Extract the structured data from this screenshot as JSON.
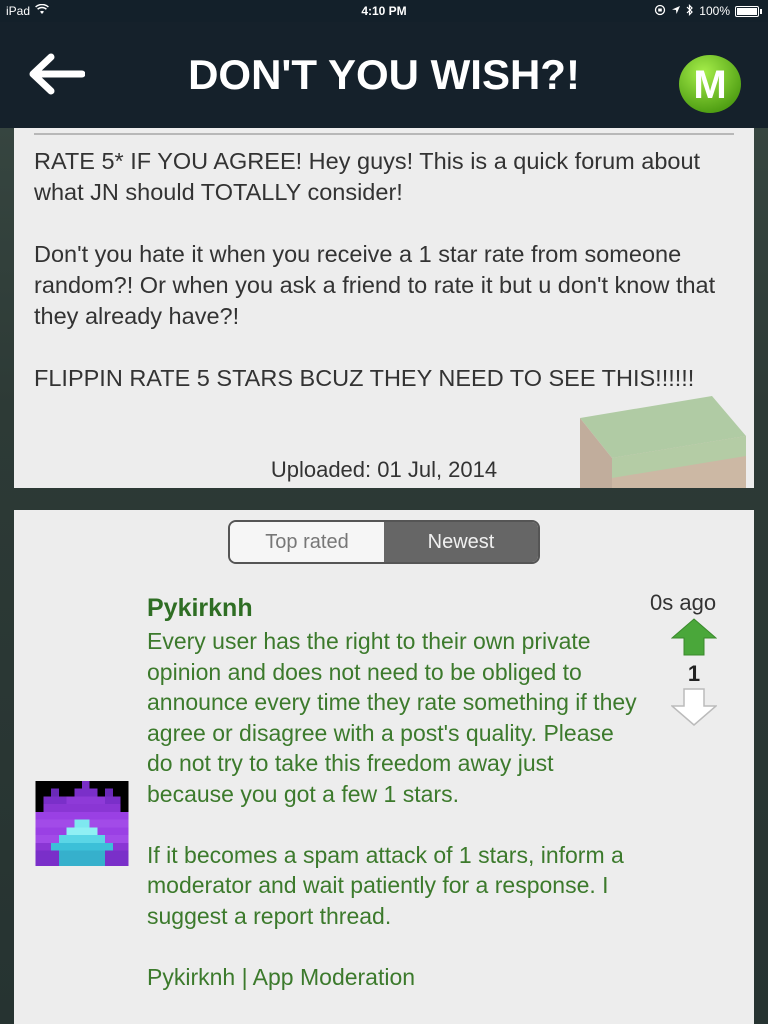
{
  "status_bar": {
    "device": "iPad",
    "time": "4:10 PM",
    "battery": "100%"
  },
  "header": {
    "title": "DON'T YOU WISH?!",
    "menu_logo": "M",
    "back_icon": "arrow-left-icon"
  },
  "post": {
    "paragraphs": [
      "RATE 5* IF YOU AGREE! Hey guys! This is a quick forum about what JN should TOTALLY consider!",
      "Don't you hate it when you receive a 1 star rate from someone random?! Or when you ask a friend to rate it but u don't know that they already have?!",
      "FLIPPIN RATE 5 STARS BCUZ THEY NEED TO SEE THIS!!!!!!"
    ],
    "uploaded": "Uploaded: 01 Jul, 2014"
  },
  "comments": {
    "tabs": [
      {
        "label": "Top rated",
        "selected": false
      },
      {
        "label": "Newest",
        "selected": true
      }
    ],
    "items": [
      {
        "author": "Pykirknh",
        "time": "0s ago",
        "votes": "1",
        "paragraphs": [
          "Every user has the right to their own private opinion and does not need to be obliged to announce every time they rate something if they agree or disagree with a post's quality. Please do not try to take this freedom away just because you got a few 1 stars.",
          "If it becomes a spam attack of 1 stars, inform a moderator and wait patiently for a response. I suggest a report thread.",
          "Pykirknh | App Moderation"
        ]
      }
    ]
  },
  "colors": {
    "nav_bg": "#15212b",
    "card_bg": "#ededed",
    "comment_green": "#3c7a2c",
    "accent_green": "#6ec623"
  }
}
